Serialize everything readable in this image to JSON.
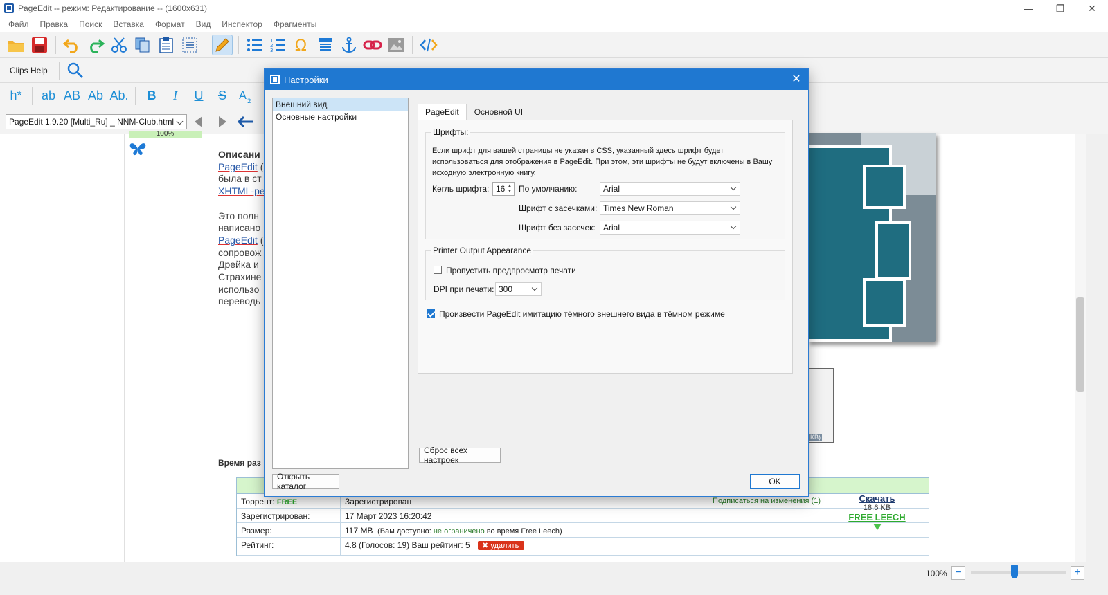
{
  "window": {
    "title": "PageEdit -- режим: Редактирование -- (1600x631)",
    "minimize": "—",
    "restore": "❐",
    "close": "✕"
  },
  "menu": [
    "Файл",
    "Правка",
    "Поиск",
    "Вставка",
    "Формат",
    "Вид",
    "Инспектор",
    "Фрагменты"
  ],
  "toolbar": {
    "clips_label": "Clips Help",
    "heading_label": "h*",
    "case_buttons": [
      "ab",
      "AB",
      "Ab",
      "Ab."
    ],
    "format_buttons": [
      "B",
      "I",
      "U",
      "S"
    ],
    "file_combo": "PageEdit 1.9.20 [Multi_Ru] _ NNM-Club.html"
  },
  "document": {
    "progress_pct": "100%",
    "desc_heading": "Описани",
    "lines": [
      {
        "text": "PageEdit",
        "link": true,
        "rest": " ("
      },
      {
        "text": "",
        "link": false,
        "rest": "была в ст"
      },
      {
        "text": "XHTML-ре",
        "link": true,
        "rest": ""
      },
      {
        "text": "",
        "link": false,
        "rest": ""
      },
      {
        "text": "",
        "link": false,
        "rest": "Это полн"
      },
      {
        "text": "",
        "link": false,
        "rest": "написано"
      },
      {
        "text": "PageEdit",
        "link": true,
        "rest": " ("
      },
      {
        "text": "",
        "link": false,
        "rest": "сопровож"
      },
      {
        "text": "",
        "link": false,
        "rest": "Дрейка и"
      },
      {
        "text": "",
        "link": false,
        "rest": "Страхине"
      },
      {
        "text": "",
        "link": false,
        "rest": "использо"
      },
      {
        "text": "",
        "link": false,
        "rest": "переводь"
      }
    ],
    "time_label": "Время раз",
    "thumb_kb": "KB)"
  },
  "info_table": {
    "rows": [
      {
        "key": "Торрент:",
        "key_extra": "FREE",
        "value": "Зарегистрирован",
        "subscribe": "Подписаться на изменения (1)"
      },
      {
        "key": "Зарегистрирован:",
        "value": "17 Март 2023 16:20:42"
      },
      {
        "key": "Размер:",
        "value": "117 MB",
        "note_prefix": "(Вам доступно: ",
        "note_avail": "не ограничено",
        "note_suffix": " во время Free Leech)"
      },
      {
        "key": "Рейтинг:",
        "value": "4.8 (Голосов: 19) Ваш рейтинг: 5",
        "delete_label": "удалить"
      }
    ],
    "download": {
      "label": "Скачать",
      "size": "18.6 KB",
      "free_leech": "FREE LEECH"
    }
  },
  "status": {
    "zoom": "100%",
    "zoom_level": 0.46
  },
  "dialog": {
    "title": "Настройки",
    "close": "✕",
    "categories": [
      "Внешний вид",
      "Основные настройки"
    ],
    "selected_category": 0,
    "open_catalog": "Открыть каталог",
    "ok": "OK",
    "reset": "Сброс всех настроек",
    "tabs": [
      "PageEdit",
      "Основной UI"
    ],
    "selected_tab": 0,
    "fonts_group": {
      "title": "Шрифты:",
      "description": "Если шрифт для вашей страницы не указан в CSS, указанный здесь шрифт будет использоваться для отображения в PageEdit. При этом, эти шрифты не будут включены в Вашу исходную электронную книгу.",
      "size_label": "Кегль шрифта:",
      "size_value": "16",
      "default_label": "По умолчанию:",
      "default_value": "Arial",
      "serif_label": "Шрифт с засечками:",
      "serif_value": "Times New Roman",
      "sans_label": "Шрифт без засечек:",
      "sans_value": "Arial"
    },
    "printer_group": {
      "title": "Printer Output Appearance",
      "skip_preview_label": "Пропустить предпросмотр печати",
      "skip_preview_checked": false,
      "dpi_label": "DPI при печати:",
      "dpi_value": "300"
    },
    "dark_mode_label": "Произвести PageEdit имитацию тёмного внешнего вида в тёмном режиме",
    "dark_mode_checked": true
  }
}
